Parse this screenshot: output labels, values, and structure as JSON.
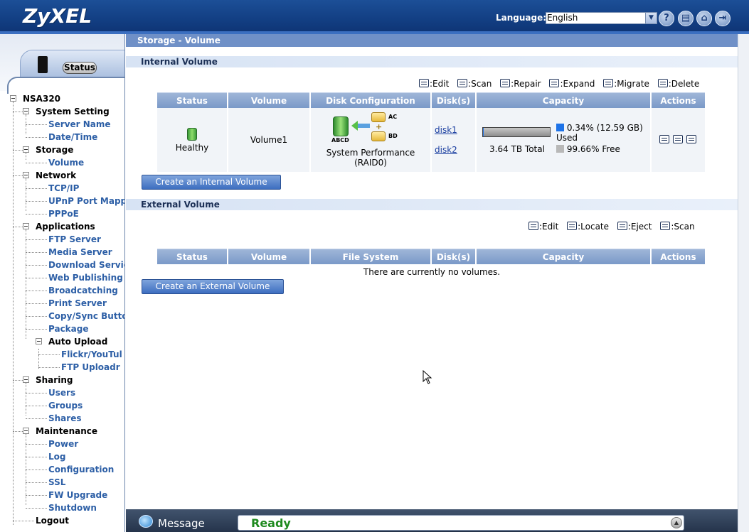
{
  "header": {
    "logo": "ZyXEL",
    "language_label": "Language:",
    "language_value": "English",
    "buttons": [
      "help-icon",
      "document-icon",
      "home-icon",
      "logout-icon"
    ]
  },
  "sidebar": {
    "status_label": "Status",
    "tree": [
      {
        "label": "NSA320",
        "kind": "root"
      },
      {
        "label": "System Setting",
        "kind": "group"
      },
      {
        "label": "Server Name",
        "kind": "leaf"
      },
      {
        "label": "Date/Time",
        "kind": "leaf"
      },
      {
        "label": "Storage",
        "kind": "group"
      },
      {
        "label": "Volume",
        "kind": "leaf"
      },
      {
        "label": "Network",
        "kind": "group"
      },
      {
        "label": "TCP/IP",
        "kind": "leaf"
      },
      {
        "label": "UPnP Port Mappi",
        "kind": "leaf"
      },
      {
        "label": "PPPoE",
        "kind": "leaf"
      },
      {
        "label": "Applications",
        "kind": "group"
      },
      {
        "label": "FTP Server",
        "kind": "leaf"
      },
      {
        "label": "Media Server",
        "kind": "leaf"
      },
      {
        "label": "Download Servic",
        "kind": "leaf"
      },
      {
        "label": "Web Publishing",
        "kind": "leaf"
      },
      {
        "label": "Broadcatching",
        "kind": "leaf"
      },
      {
        "label": "Print Server",
        "kind": "leaf"
      },
      {
        "label": "Copy/Sync Butto",
        "kind": "leaf"
      },
      {
        "label": "Package",
        "kind": "leaf"
      },
      {
        "label": "Auto Upload",
        "kind": "subgroup"
      },
      {
        "label": "Flickr/YouTul",
        "kind": "subleaf"
      },
      {
        "label": "FTP Uploadr",
        "kind": "subleaf"
      },
      {
        "label": "Sharing",
        "kind": "group"
      },
      {
        "label": "Users",
        "kind": "leaf"
      },
      {
        "label": "Groups",
        "kind": "leaf"
      },
      {
        "label": "Shares",
        "kind": "leaf"
      },
      {
        "label": "Maintenance",
        "kind": "group"
      },
      {
        "label": "Power",
        "kind": "leaf"
      },
      {
        "label": "Log",
        "kind": "leaf"
      },
      {
        "label": "Configuration",
        "kind": "leaf"
      },
      {
        "label": "SSL",
        "kind": "leaf"
      },
      {
        "label": "FW Upgrade",
        "kind": "leaf"
      },
      {
        "label": "Shutdown",
        "kind": "leaf"
      },
      {
        "label": "Logout",
        "kind": "group"
      }
    ]
  },
  "main": {
    "page_title": "Storage - Volume",
    "internal": {
      "section_title": "Internal Volume",
      "toolbar": {
        "edit": ":Edit",
        "scan": ":Scan",
        "repair": ":Repair",
        "expand": ":Expand",
        "migrate": ":Migrate",
        "delete": ":Delete"
      },
      "columns": {
        "status": "Status",
        "volume": "Volume",
        "disk_config": "Disk Configuration",
        "disks": "Disk(s)",
        "capacity": "Capacity",
        "actions": "Actions"
      },
      "row": {
        "status": "Healthy",
        "volume": "Volume1",
        "config_line1": "System Performance",
        "config_line2": "(RAID0)",
        "raid_abcd": "ABCD",
        "raid_ac": "AC",
        "raid_bd": "BD",
        "disk1": "disk1",
        "disk2": "disk2",
        "total": "3.64 TB Total",
        "used": "0.34% (12.59 GB)",
        "used_suffix": "Used",
        "free": "99.66% Free",
        "used_percent": 0.34,
        "used_color": "#1e73e8",
        "free_color": "#b8b8b8"
      },
      "create_button": "Create an Internal Volume"
    },
    "external": {
      "section_title": "External Volume",
      "toolbar": {
        "edit": ":Edit",
        "locate": ":Locate",
        "eject": ":Eject",
        "scan": ":Scan"
      },
      "columns": {
        "status": "Status",
        "volume": "Volume",
        "file_system": "File System",
        "disks": "Disk(s)",
        "capacity": "Capacity",
        "actions": "Actions"
      },
      "empty_message": "There are currently no volumes.",
      "create_button": "Create an External Volume"
    }
  },
  "statusbar": {
    "message_label": "Message",
    "message_text": "Ready"
  },
  "colors": {
    "header_bg": "#123e82",
    "title_bar": "#6f90c7",
    "ready_text": "#1e8a1e"
  }
}
